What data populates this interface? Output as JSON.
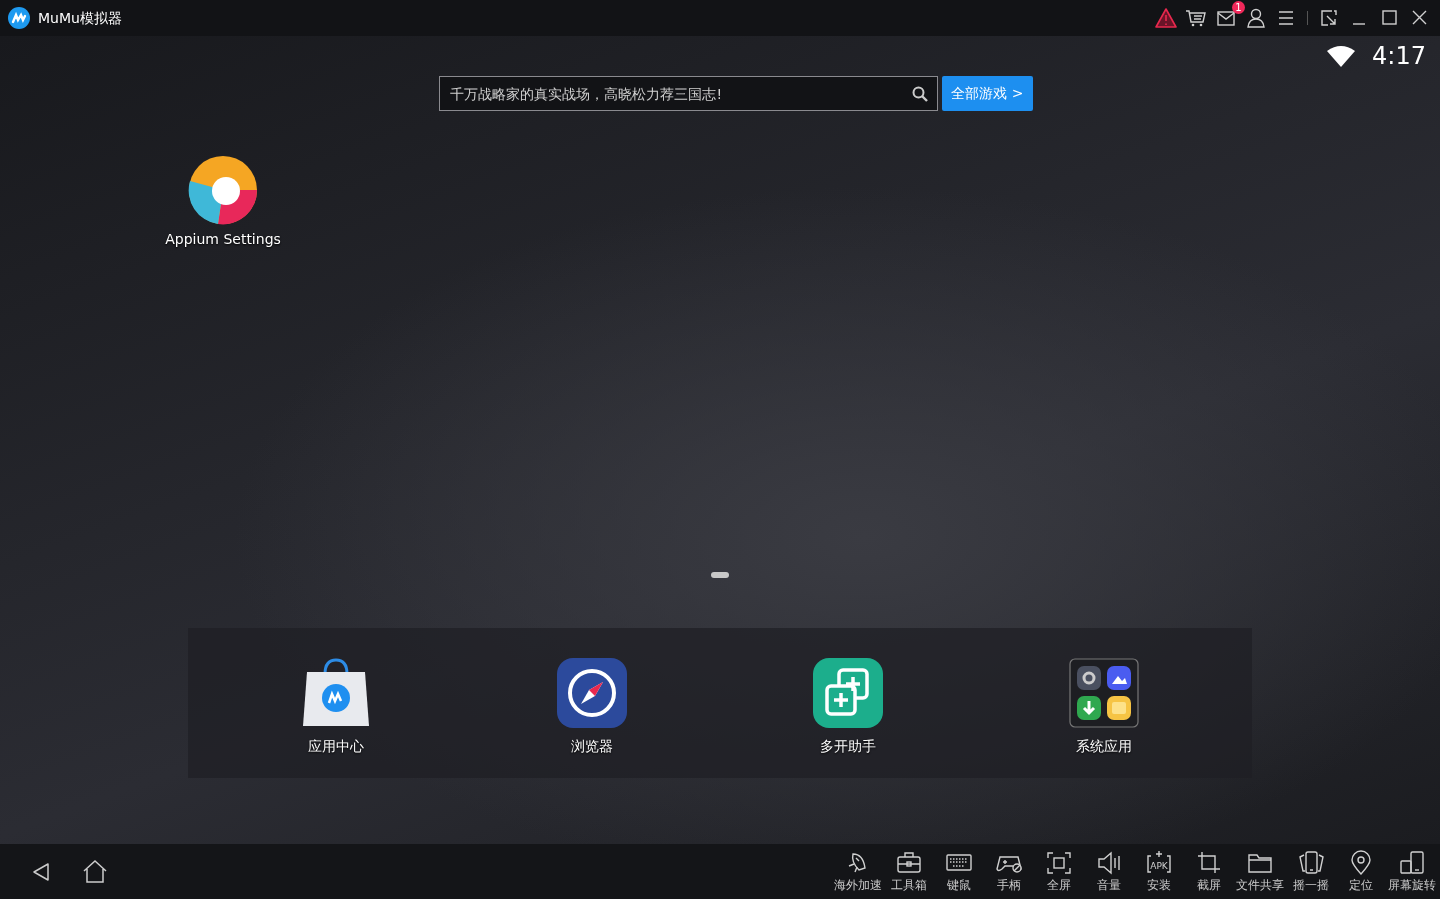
{
  "window": {
    "title": "MuMu模拟器",
    "mail_badge": "1"
  },
  "status_bar": {
    "time": "4:17"
  },
  "search": {
    "placeholder": "千万战略家的真实战场，高晓松力荐三国志!",
    "button": "全部游戏 >"
  },
  "desktop_apps": [
    {
      "kind": "appium",
      "label": "Appium Settings"
    }
  ],
  "pages": [
    {
      "selected": true
    }
  ],
  "dock": [
    {
      "kind": "store",
      "label": "应用中心"
    },
    {
      "kind": "browser",
      "label": "浏览器"
    },
    {
      "kind": "multi",
      "label": "多开助手"
    },
    {
      "kind": "folder",
      "label": "系统应用"
    }
  ],
  "toolbar": [
    {
      "kind": "rocket",
      "label": "海外加速"
    },
    {
      "kind": "toolbox",
      "label": "工具箱"
    },
    {
      "kind": "keyboard",
      "label": "键鼠"
    },
    {
      "kind": "gamepad",
      "label": "手柄"
    },
    {
      "kind": "fullscreen",
      "label": "全屏"
    },
    {
      "kind": "volume",
      "label": "音量"
    },
    {
      "kind": "apk",
      "label": "安装",
      "icon_text": "APK"
    },
    {
      "kind": "crop",
      "label": "截屏"
    },
    {
      "kind": "folder",
      "label": "文件共享"
    },
    {
      "kind": "shake",
      "label": "摇一摇"
    },
    {
      "kind": "location",
      "label": "定位"
    },
    {
      "kind": "rotate",
      "label": "屏幕旋转"
    }
  ]
}
